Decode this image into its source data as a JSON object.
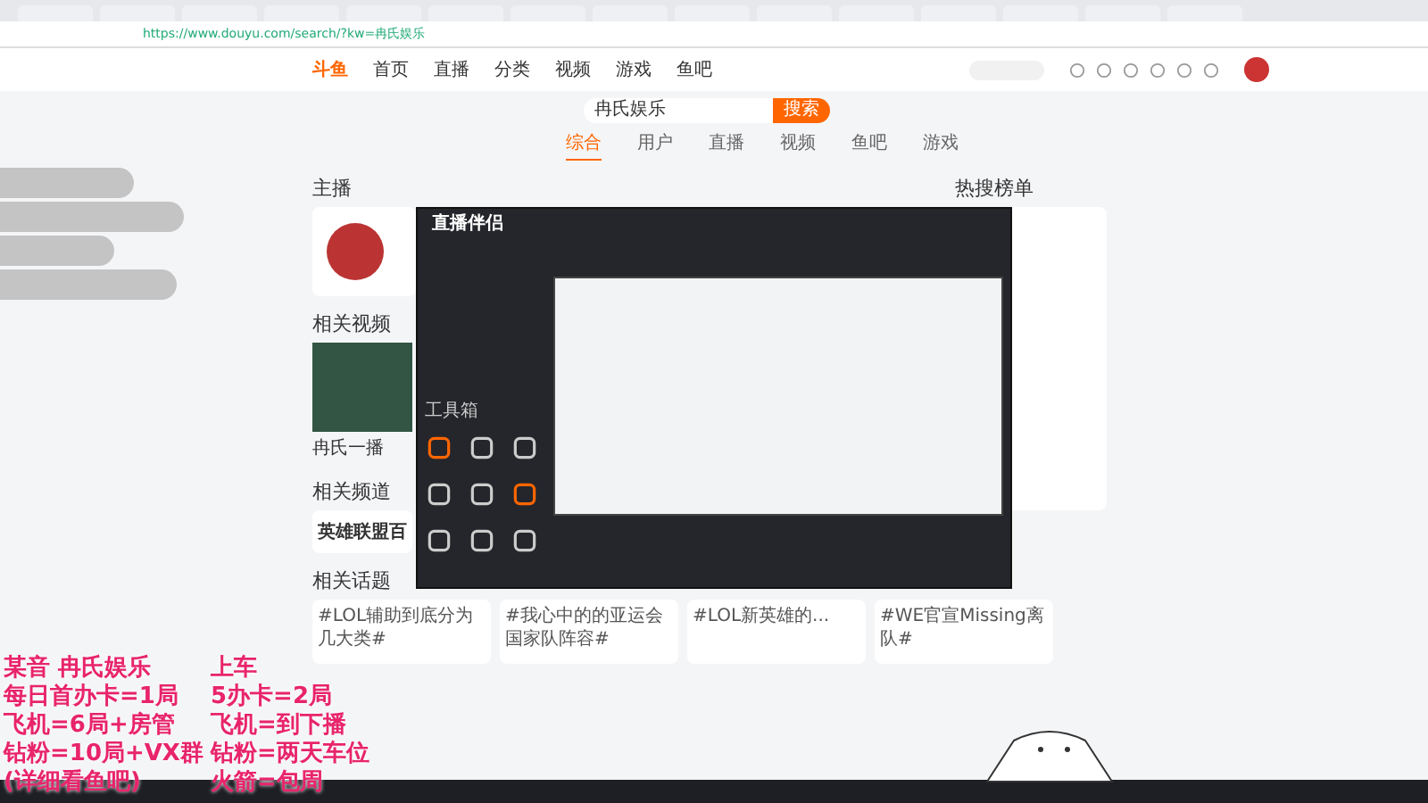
{
  "browser": {
    "address": "https://www.douyu.com/search/?kw=冉氏娱乐"
  },
  "site": {
    "logo": "斗鱼",
    "nav": [
      {
        "label": "首页"
      },
      {
        "label": "直播"
      },
      {
        "label": "分类"
      },
      {
        "label": "视频"
      },
      {
        "label": "游戏"
      },
      {
        "label": "鱼吧"
      }
    ]
  },
  "search": {
    "value": "冉氏娱乐",
    "button": "搜索"
  },
  "result_tabs": [
    {
      "label": "综合",
      "selected": true
    },
    {
      "label": "用户",
      "selected": false
    },
    {
      "label": "直播",
      "selected": false
    },
    {
      "label": "视频",
      "selected": false
    },
    {
      "label": "鱼吧",
      "selected": false
    },
    {
      "label": "游戏",
      "selected": false
    }
  ],
  "sections": {
    "anchor": "主播",
    "videos": "相关视频",
    "channels": "相关频道",
    "topics": "相关话题",
    "hot": "热搜榜单"
  },
  "video": {
    "title": "冉氏一播"
  },
  "channel": {
    "name": "英雄联盟百"
  },
  "topics": [
    {
      "title": "#LOL辅助到底分为几大类#"
    },
    {
      "title": "#我心中的的亚运会国家队阵容#"
    },
    {
      "title": "#LOL新英雄的..."
    },
    {
      "title": "#WE官宣Missing离队#"
    }
  ],
  "app": {
    "title": "直播伴侣",
    "toolbox": "工具箱"
  },
  "overlay_lines": [
    {
      "left": "某音  冉氏娱乐",
      "right": "上车"
    },
    {
      "left": "每日首办卡=1局",
      "right": "5办卡=2局"
    },
    {
      "left": "飞机=6局+房管",
      "right": "飞机=到下播"
    },
    {
      "left": "钻粉=10局+VX群",
      "right": "钻粉=两天车位"
    },
    {
      "left": "(详细看鱼吧)",
      "right": "火箭=包周"
    }
  ]
}
